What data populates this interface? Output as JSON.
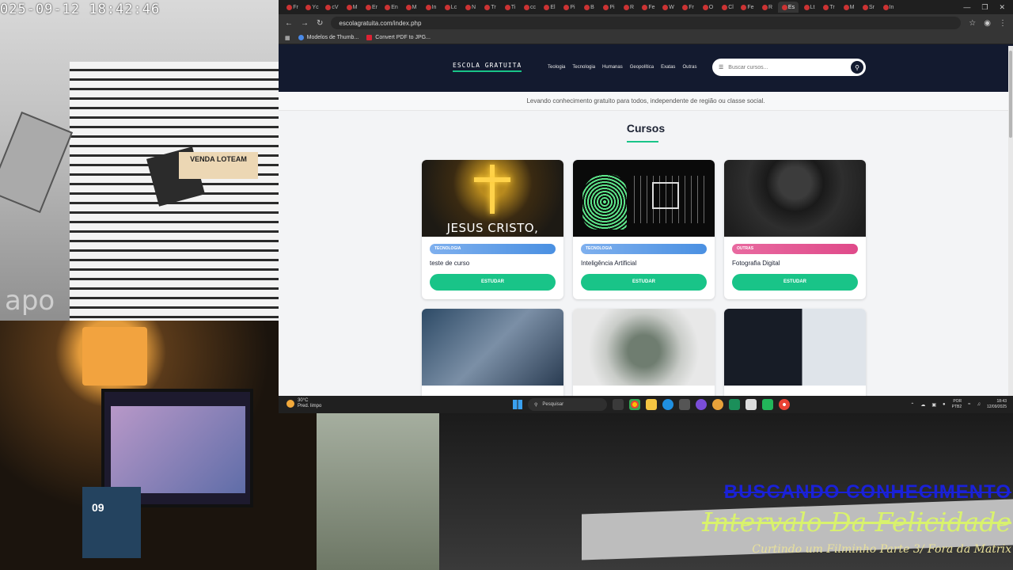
{
  "camera": {
    "timestamp": "025-09-12  18:42:46",
    "brand": "apo",
    "sign_text": "VENDA  LOTEAM"
  },
  "desk_cam": {
    "box_label": "09"
  },
  "overlay": {
    "line1": "BUSCANDO CONHECIMENTO",
    "line2": "Intervalo Da Felicidade",
    "line3": "Curtindo um Filminho Parte 3/ Fora da Matrix"
  },
  "browser": {
    "address": "escolagratuita.com/index.php",
    "bookmarks": [
      {
        "label": "Modelos de Thumb..."
      },
      {
        "label": "Convert PDF to JPG..."
      }
    ],
    "tabs": [
      "Fr",
      "Yc",
      "cV",
      "M",
      "Er",
      "En",
      "M",
      "In",
      "Lc",
      "N",
      "Tr",
      "Ti",
      "cc",
      "El",
      "Pi",
      "B",
      "Pi",
      "R",
      "Fe",
      "W",
      "Fr",
      "O",
      "Cl",
      "Fe",
      "R",
      "Es",
      "Lt",
      "Tr",
      "M",
      "Sr",
      "In"
    ]
  },
  "site": {
    "logo": "ESCOLA GRATUITA",
    "nav": [
      "Teologia",
      "Tecnologia",
      "Humanas",
      "Geopolítica",
      "Exatas",
      "Outras"
    ],
    "search_placeholder": "Buscar cursos...",
    "tagline": "Levando conhecimento gratuito para todos, independente de região ou classe social.",
    "section_title": "Cursos",
    "courses": [
      {
        "category": "TECNOLOGIA",
        "title": "teste de curso",
        "image_text": "JESUS CRISTO,",
        "button": "ESTUDAR",
        "badge_color": "#4a90e2"
      },
      {
        "category": "TECNOLOGIA",
        "title": "Inteligência Artificial",
        "button": "ESTUDAR",
        "badge_color": "#4a90e2"
      },
      {
        "category": "OUTRAS",
        "title": "Fotografia Digital",
        "button": "ESTUDAR",
        "badge_color": "#e04a8a"
      }
    ],
    "accent_color": "#19c488"
  },
  "taskbar": {
    "weather_temp": "30°C",
    "weather_desc": "Pred. limpo",
    "search_placeholder": "Pesquisar",
    "lang": "POR",
    "lang2": "PTB2",
    "time": "18:43",
    "date": "12/09/2025"
  }
}
